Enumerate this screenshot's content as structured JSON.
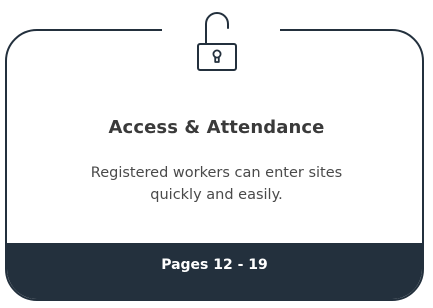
{
  "card": {
    "icon": "padlock-icon",
    "title": "Access & Attendance",
    "description": "Registered workers can enter sites quickly and easily.",
    "footer_label": "Pages 12 - 19"
  },
  "colors": {
    "dark": "#23303d",
    "title_text": "#3a3a3a",
    "body_text": "#4a4a4a",
    "background": "#ffffff"
  }
}
